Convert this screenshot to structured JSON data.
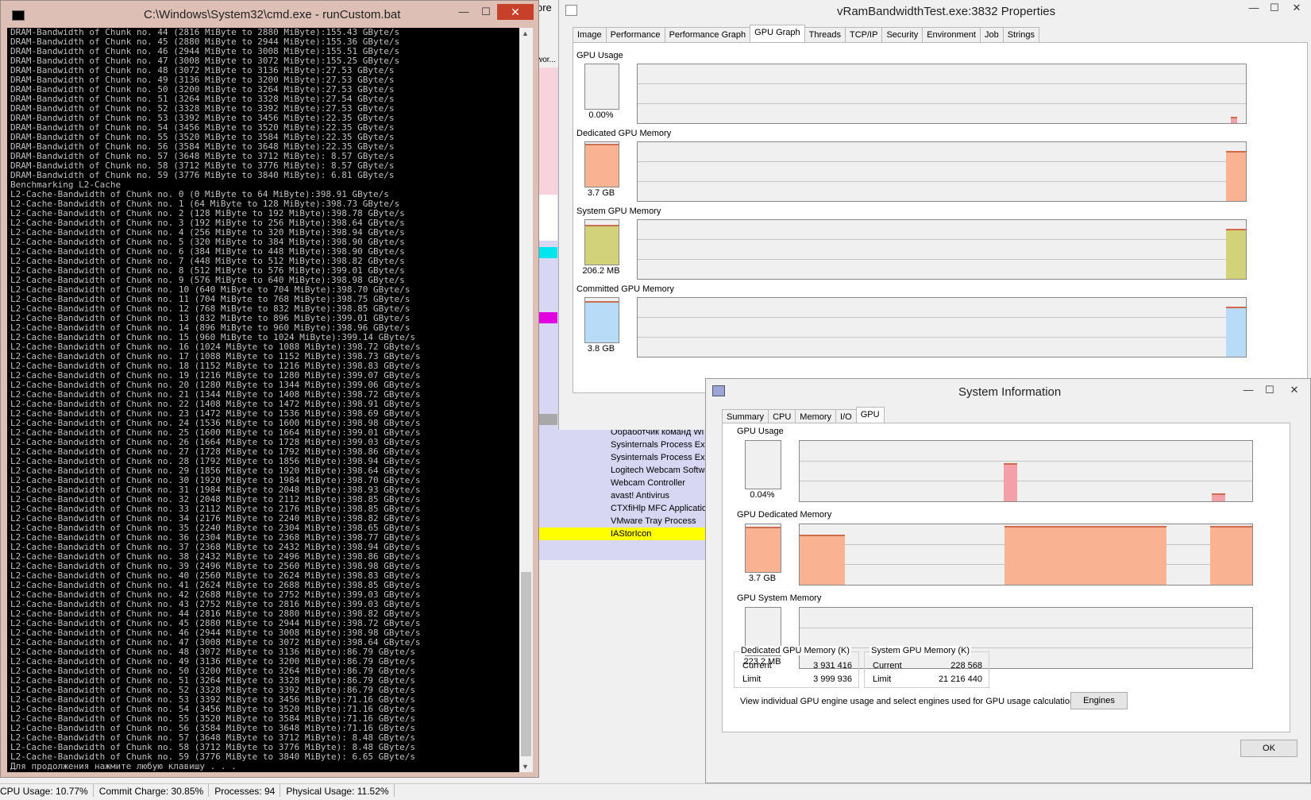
{
  "background": {
    "top_label": "ore",
    "top_label2": "wor...",
    "process_names": [
      "Обработчик команд Wi",
      "Sysinternals Process Exp",
      "Sysinternals Process Exp",
      "Logitech Webcam Softwa",
      "Webcam Controller",
      "avast! Antivirus",
      "CTXfiHlp MFC Application",
      "VMware Tray Process",
      "IAStorIcon"
    ]
  },
  "statusbar": {
    "cpu": "CPU Usage: 10.77%",
    "commit": "Commit Charge: 30.85%",
    "processes": "Processes: 94",
    "physical": "Physical Usage: 11.52%"
  },
  "cmd": {
    "title": "C:\\Windows\\System32\\cmd.exe - runCustom.bat",
    "icon": "cmd-icon",
    "minimize": "—",
    "maximize": "☐",
    "close": "✕",
    "lines": [
      "DRAM-Bandwidth of Chunk no. 44 (2816 MiByte to 2880 MiByte):155.43 GByte/s",
      "DRAM-Bandwidth of Chunk no. 45 (2880 MiByte to 2944 MiByte):155.36 GByte/s",
      "DRAM-Bandwidth of Chunk no. 46 (2944 MiByte to 3008 MiByte):155.51 GByte/s",
      "DRAM-Bandwidth of Chunk no. 47 (3008 MiByte to 3072 MiByte):155.25 GByte/s",
      "DRAM-Bandwidth of Chunk no. 48 (3072 MiByte to 3136 MiByte):27.53 GByte/s",
      "DRAM-Bandwidth of Chunk no. 49 (3136 MiByte to 3200 MiByte):27.53 GByte/s",
      "DRAM-Bandwidth of Chunk no. 50 (3200 MiByte to 3264 MiByte):27.53 GByte/s",
      "DRAM-Bandwidth of Chunk no. 51 (3264 MiByte to 3328 MiByte):27.54 GByte/s",
      "DRAM-Bandwidth of Chunk no. 52 (3328 MiByte to 3392 MiByte):27.53 GByte/s",
      "DRAM-Bandwidth of Chunk no. 53 (3392 MiByte to 3456 MiByte):22.35 GByte/s",
      "DRAM-Bandwidth of Chunk no. 54 (3456 MiByte to 3520 MiByte):22.35 GByte/s",
      "DRAM-Bandwidth of Chunk no. 55 (3520 MiByte to 3584 MiByte):22.35 GByte/s",
      "DRAM-Bandwidth of Chunk no. 56 (3584 MiByte to 3648 MiByte):22.35 GByte/s",
      "DRAM-Bandwidth of Chunk no. 57 (3648 MiByte to 3712 MiByte): 8.57 GByte/s",
      "DRAM-Bandwidth of Chunk no. 58 (3712 MiByte to 3776 MiByte): 8.57 GByte/s",
      "DRAM-Bandwidth of Chunk no. 59 (3776 MiByte to 3840 MiByte): 6.81 GByte/s",
      "Benchmarking L2-Cache",
      "L2-Cache-Bandwidth of Chunk no. 0 (0 MiByte to 64 MiByte):398.91 GByte/s",
      "L2-Cache-Bandwidth of Chunk no. 1 (64 MiByte to 128 MiByte):398.73 GByte/s",
      "L2-Cache-Bandwidth of Chunk no. 2 (128 MiByte to 192 MiByte):398.78 GByte/s",
      "L2-Cache-Bandwidth of Chunk no. 3 (192 MiByte to 256 MiByte):398.64 GByte/s",
      "L2-Cache-Bandwidth of Chunk no. 4 (256 MiByte to 320 MiByte):398.94 GByte/s",
      "L2-Cache-Bandwidth of Chunk no. 5 (320 MiByte to 384 MiByte):398.90 GByte/s",
      "L2-Cache-Bandwidth of Chunk no. 6 (384 MiByte to 448 MiByte):398.90 GByte/s",
      "L2-Cache-Bandwidth of Chunk no. 7 (448 MiByte to 512 MiByte):398.82 GByte/s",
      "L2-Cache-Bandwidth of Chunk no. 8 (512 MiByte to 576 MiByte):399.01 GByte/s",
      "L2-Cache-Bandwidth of Chunk no. 9 (576 MiByte to 640 MiByte):398.98 GByte/s",
      "L2-Cache-Bandwidth of Chunk no. 10 (640 MiByte to 704 MiByte):398.70 GByte/s",
      "L2-Cache-Bandwidth of Chunk no. 11 (704 MiByte to 768 MiByte):398.75 GByte/s",
      "L2-Cache-Bandwidth of Chunk no. 12 (768 MiByte to 832 MiByte):398.85 GByte/s",
      "L2-Cache-Bandwidth of Chunk no. 13 (832 MiByte to 896 MiByte):399.01 GByte/s",
      "L2-Cache-Bandwidth of Chunk no. 14 (896 MiByte to 960 MiByte):398.96 GByte/s",
      "L2-Cache-Bandwidth of Chunk no. 15 (960 MiByte to 1024 MiByte):399.14 GByte/s",
      "L2-Cache-Bandwidth of Chunk no. 16 (1024 MiByte to 1088 MiByte):398.72 GByte/s",
      "L2-Cache-Bandwidth of Chunk no. 17 (1088 MiByte to 1152 MiByte):398.73 GByte/s",
      "L2-Cache-Bandwidth of Chunk no. 18 (1152 MiByte to 1216 MiByte):398.83 GByte/s",
      "L2-Cache-Bandwidth of Chunk no. 19 (1216 MiByte to 1280 MiByte):399.07 GByte/s",
      "L2-Cache-Bandwidth of Chunk no. 20 (1280 MiByte to 1344 MiByte):399.06 GByte/s",
      "L2-Cache-Bandwidth of Chunk no. 21 (1344 MiByte to 1408 MiByte):398.72 GByte/s",
      "L2-Cache-Bandwidth of Chunk no. 22 (1408 MiByte to 1472 MiByte):398.91 GByte/s",
      "L2-Cache-Bandwidth of Chunk no. 23 (1472 MiByte to 1536 MiByte):398.69 GByte/s",
      "L2-Cache-Bandwidth of Chunk no. 24 (1536 MiByte to 1600 MiByte):398.98 GByte/s",
      "L2-Cache-Bandwidth of Chunk no. 25 (1600 MiByte to 1664 MiByte):399.01 GByte/s",
      "L2-Cache-Bandwidth of Chunk no. 26 (1664 MiByte to 1728 MiByte):399.03 GByte/s",
      "L2-Cache-Bandwidth of Chunk no. 27 (1728 MiByte to 1792 MiByte):398.86 GByte/s",
      "L2-Cache-Bandwidth of Chunk no. 28 (1792 MiByte to 1856 MiByte):398.94 GByte/s",
      "L2-Cache-Bandwidth of Chunk no. 29 (1856 MiByte to 1920 MiByte):398.64 GByte/s",
      "L2-Cache-Bandwidth of Chunk no. 30 (1920 MiByte to 1984 MiByte):398.70 GByte/s",
      "L2-Cache-Bandwidth of Chunk no. 31 (1984 MiByte to 2048 MiByte):398.93 GByte/s",
      "L2-Cache-Bandwidth of Chunk no. 32 (2048 MiByte to 2112 MiByte):398.85 GByte/s",
      "L2-Cache-Bandwidth of Chunk no. 33 (2112 MiByte to 2176 MiByte):398.85 GByte/s",
      "L2-Cache-Bandwidth of Chunk no. 34 (2176 MiByte to 2240 MiByte):398.82 GByte/s",
      "L2-Cache-Bandwidth of Chunk no. 35 (2240 MiByte to 2304 MiByte):398.65 GByte/s",
      "L2-Cache-Bandwidth of Chunk no. 36 (2304 MiByte to 2368 MiByte):398.77 GByte/s",
      "L2-Cache-Bandwidth of Chunk no. 37 (2368 MiByte to 2432 MiByte):398.94 GByte/s",
      "L2-Cache-Bandwidth of Chunk no. 38 (2432 MiByte to 2496 MiByte):398.86 GByte/s",
      "L2-Cache-Bandwidth of Chunk no. 39 (2496 MiByte to 2560 MiByte):398.98 GByte/s",
      "L2-Cache-Bandwidth of Chunk no. 40 (2560 MiByte to 2624 MiByte):398.83 GByte/s",
      "L2-Cache-Bandwidth of Chunk no. 41 (2624 MiByte to 2688 MiByte):398.85 GByte/s",
      "L2-Cache-Bandwidth of Chunk no. 42 (2688 MiByte to 2752 MiByte):399.03 GByte/s",
      "L2-Cache-Bandwidth of Chunk no. 43 (2752 MiByte to 2816 MiByte):399.03 GByte/s",
      "L2-Cache-Bandwidth of Chunk no. 44 (2816 MiByte to 2880 MiByte):398.82 GByte/s",
      "L2-Cache-Bandwidth of Chunk no. 45 (2880 MiByte to 2944 MiByte):398.72 GByte/s",
      "L2-Cache-Bandwidth of Chunk no. 46 (2944 MiByte to 3008 MiByte):398.98 GByte/s",
      "L2-Cache-Bandwidth of Chunk no. 47 (3008 MiByte to 3072 MiByte):398.64 GByte/s",
      "L2-Cache-Bandwidth of Chunk no. 48 (3072 MiByte to 3136 MiByte):86.79 GByte/s",
      "L2-Cache-Bandwidth of Chunk no. 49 (3136 MiByte to 3200 MiByte):86.79 GByte/s",
      "L2-Cache-Bandwidth of Chunk no. 50 (3200 MiByte to 3264 MiByte):86.79 GByte/s",
      "L2-Cache-Bandwidth of Chunk no. 51 (3264 MiByte to 3328 MiByte):86.79 GByte/s",
      "L2-Cache-Bandwidth of Chunk no. 52 (3328 MiByte to 3392 MiByte):86.79 GByte/s",
      "L2-Cache-Bandwidth of Chunk no. 53 (3392 MiByte to 3456 MiByte):71.16 GByte/s",
      "L2-Cache-Bandwidth of Chunk no. 54 (3456 MiByte to 3520 MiByte):71.16 GByte/s",
      "L2-Cache-Bandwidth of Chunk no. 55 (3520 MiByte to 3584 MiByte):71.16 GByte/s",
      "L2-Cache-Bandwidth of Chunk no. 56 (3584 MiByte to 3648 MiByte):71.16 GByte/s",
      "L2-Cache-Bandwidth of Chunk no. 57 (3648 MiByte to 3712 MiByte): 8.48 GByte/s",
      "L2-Cache-Bandwidth of Chunk no. 58 (3712 MiByte to 3776 MiByte): 8.48 GByte/s",
      "L2-Cache-Bandwidth of Chunk no. 59 (3776 MiByte to 3840 MiByte): 6.65 GByte/s",
      "Для продолжения нажмите любую клавишу . . ."
    ]
  },
  "props": {
    "title": "vRamBandwidthTest.exe:3832 Properties",
    "tabs": [
      "Image",
      "Performance",
      "Performance Graph",
      "GPU Graph",
      "Threads",
      "TCP/IP",
      "Security",
      "Environment",
      "Job",
      "Strings"
    ],
    "active_tab": "GPU Graph",
    "graphs": [
      {
        "label": "GPU Usage",
        "value": "0.00%",
        "level": 0.0,
        "color": "#f4a0a8"
      },
      {
        "label": "Dedicated GPU Memory",
        "value": "3.7 GB",
        "level": 0.92,
        "color": "#f9b392"
      },
      {
        "label": "System GPU Memory",
        "value": "206.2 MB",
        "level": 0.85,
        "color": "#d1d27a"
      },
      {
        "label": "Committed GPU Memory",
        "value": "3.8 GB",
        "level": 0.9,
        "color": "#b8dbf8"
      }
    ]
  },
  "sysinfo": {
    "title": "System Information",
    "tabs": [
      "Summary",
      "CPU",
      "Memory",
      "I/O",
      "GPU"
    ],
    "active_tab": "GPU",
    "graphs": [
      {
        "label": "GPU Usage",
        "value": "0.04%",
        "level": 0.0,
        "color": "#f4a0a8"
      },
      {
        "label": "GPU Dedicated Memory",
        "value": "3.7 GB",
        "level": 0.92,
        "color": "#f9b392"
      },
      {
        "label": "GPU System Memory",
        "value": "223.2 MB",
        "level": 0.0,
        "color": "#d1d27a"
      }
    ],
    "dedicated_group": {
      "caption": "Dedicated GPU Memory (K)",
      "current_label": "Current",
      "current": "3 931 416",
      "limit_label": "Limit",
      "limit": "3 999 936"
    },
    "system_group": {
      "caption": "System GPU Memory (K)",
      "current_label": "Current",
      "current": "228 568",
      "limit_label": "Limit",
      "limit": "21 216 440"
    },
    "engines_text": "View individual GPU engine usage and select engines used for GPU usage calculations:",
    "engines_button": "Engines",
    "ok_button": "OK"
  }
}
